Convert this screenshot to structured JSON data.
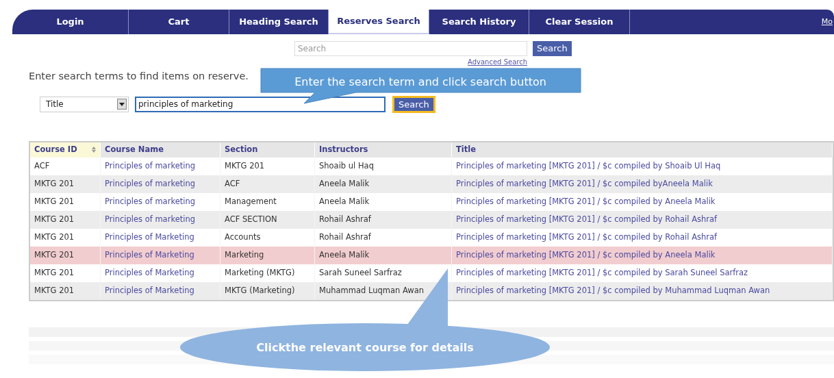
{
  "nav": {
    "tabs": [
      {
        "label": "Login",
        "selected": false
      },
      {
        "label": "Cart",
        "selected": false
      },
      {
        "label": "Heading Search",
        "selected": false
      },
      {
        "label": "Reserves Search",
        "selected": true
      },
      {
        "label": "Search History",
        "selected": false
      },
      {
        "label": "Clear Session",
        "selected": false
      }
    ],
    "more_link": "Mo"
  },
  "quick_search": {
    "placeholder": "Search",
    "button": "Search",
    "advanced_link": "Advanced Search"
  },
  "intro": "Enter search terms to find items on reserve.",
  "search_form": {
    "field": "Title",
    "value": "principles of marketing",
    "button": "Search"
  },
  "table": {
    "columns": [
      "Course ID",
      "Course Name",
      "Section",
      "Instructors",
      "Title"
    ],
    "rows": [
      {
        "cells": [
          "ACF",
          "Principles of marketing",
          "MKTG 201",
          "Shoaib ul Haq",
          "Principles of marketing [MKTG 201] / $c compiled by Shoaib Ul Haq"
        ],
        "selected": false
      },
      {
        "cells": [
          "MKTG 201",
          "Principles of marketing",
          "ACF",
          "Aneela Malik",
          "Principles of marketing [MKTG 201] / $c compiled byAneela Malik"
        ],
        "selected": false
      },
      {
        "cells": [
          "MKTG 201",
          "Principles of marketing",
          "Management",
          "Aneela Malik",
          "Principles of marketing [MKTG 201] / $c compiled by Aneela Malik"
        ],
        "selected": false
      },
      {
        "cells": [
          "MKTG 201",
          "Principles of marketing",
          "ACF SECTION",
          "Rohail Ashraf",
          "Principles of marketing [MKTG 201] / $c compiled by Rohail Ashraf"
        ],
        "selected": false
      },
      {
        "cells": [
          "MKTG 201",
          "Principles of Marketing",
          "Accounts",
          "Rohail Ashraf",
          "Principles of marketing [MKTG 201] / $c compiled by Rohail Ashraf"
        ],
        "selected": false
      },
      {
        "cells": [
          "MKTG 201",
          "Principles of Marketing",
          "Marketing",
          "Aneela Malik",
          "Principles of marketing [MKTG 201] / $c compiled by Aneela Malik"
        ],
        "selected": true
      },
      {
        "cells": [
          "MKTG 201",
          "Principles of Marketing",
          "Marketing (MKTG)",
          "Sarah Suneel Sarfraz",
          "Principles of marketing [MKTG 201] / $c compiled by Sarah Suneel Sarfraz"
        ],
        "selected": false
      },
      {
        "cells": [
          "MKTG 201",
          "Principles of Marketing",
          "MKTG (Marketing)",
          "Muhammad Luqman Awan",
          "Principles of marketing [MKTG 201] / $c compiled by Muhammad Luqman Awan"
        ],
        "selected": false
      }
    ]
  },
  "callouts": [
    {
      "text": "Enter the search term and click search button"
    },
    {
      "text": "Clickthe relevant course for details"
    }
  ]
}
